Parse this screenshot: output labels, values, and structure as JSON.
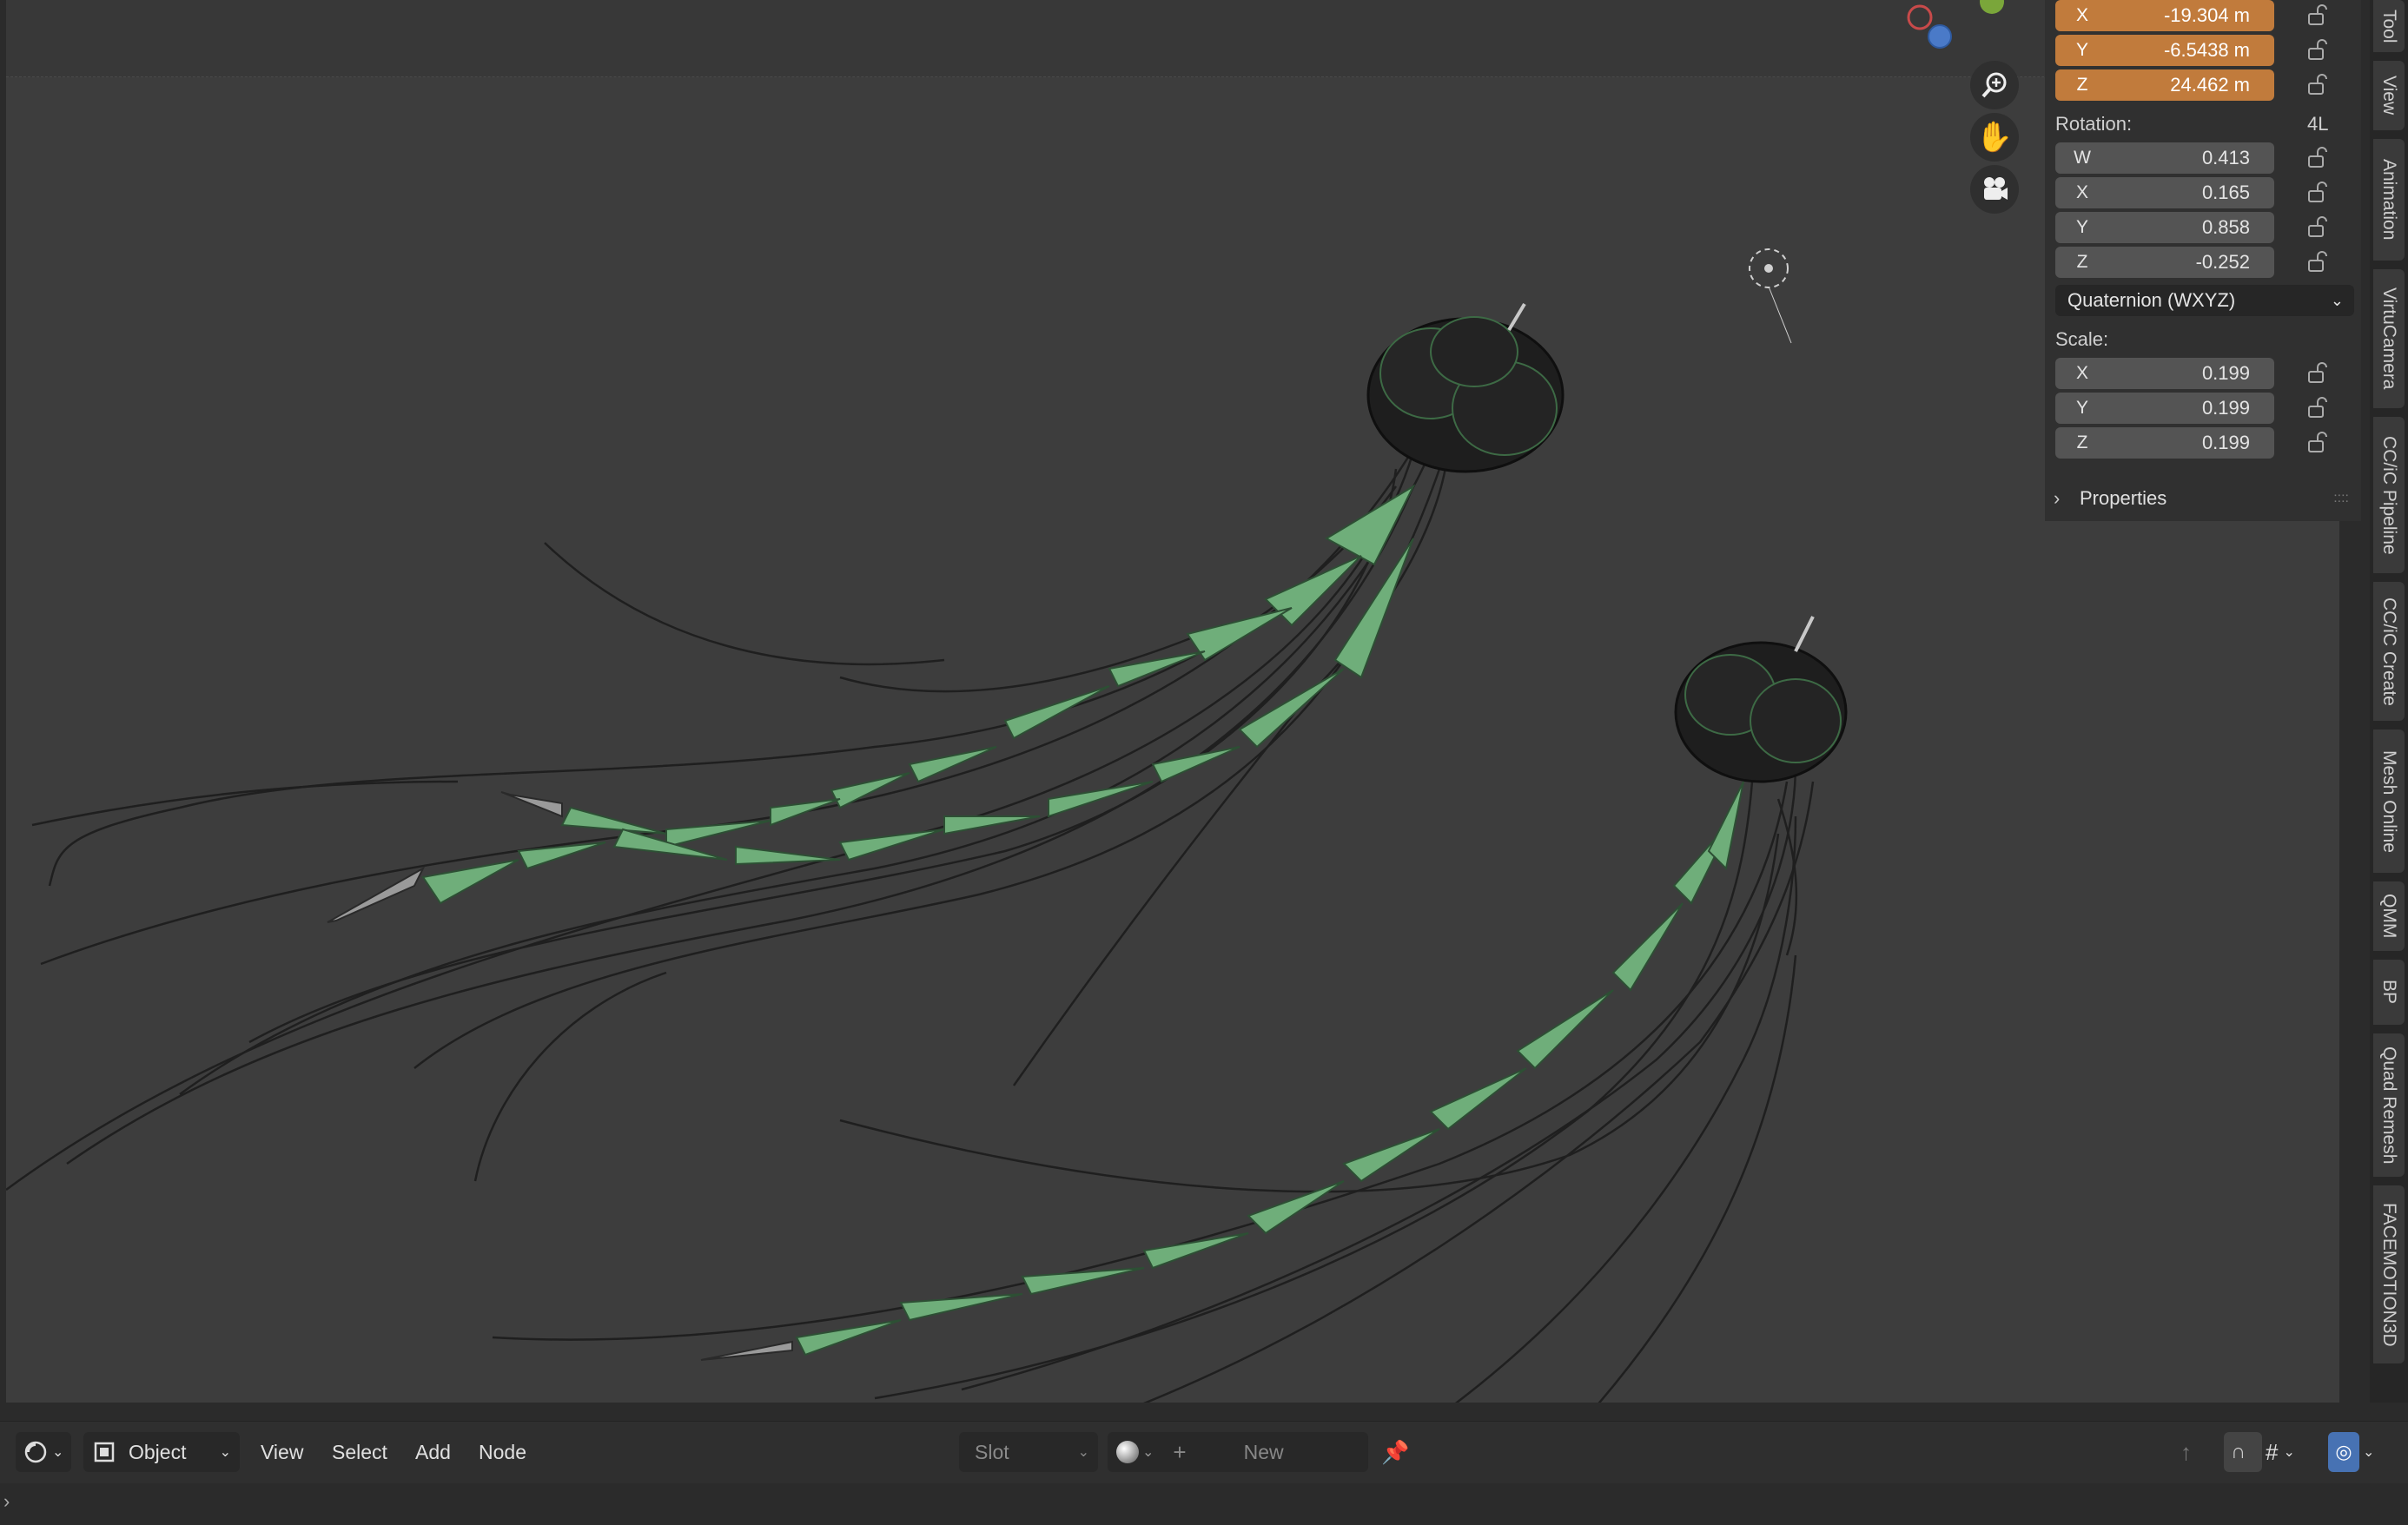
{
  "transform": {
    "location": [
      {
        "axis": "X",
        "value": "-19.304 m"
      },
      {
        "axis": "Y",
        "value": "-6.5438 m"
      },
      {
        "axis": "Z",
        "value": "24.462 m"
      }
    ],
    "rotation_label": "Rotation:",
    "rotation_mode_short": "4L",
    "rotation": [
      {
        "axis": "W",
        "value": "0.413"
      },
      {
        "axis": "X",
        "value": "0.165"
      },
      {
        "axis": "Y",
        "value": "0.858"
      },
      {
        "axis": "Z",
        "value": "-0.252"
      }
    ],
    "rotation_mode": "Quaternion (WXYZ)",
    "scale_label": "Scale:",
    "scale": [
      {
        "axis": "X",
        "value": "0.199"
      },
      {
        "axis": "Y",
        "value": "0.199"
      },
      {
        "axis": "Z",
        "value": "0.199"
      }
    ],
    "properties_label": "Properties"
  },
  "side_tabs": [
    "Tool",
    "View",
    "Animation",
    "VirtuCamera",
    "CC/iC Pipeline",
    "CC/iC Create",
    "Mesh Online",
    "QMM",
    "BP",
    "Quad Remesh",
    "FACEMOTION3D"
  ],
  "header": {
    "mode": "Object",
    "menus": [
      "View",
      "Select",
      "Add",
      "Node"
    ],
    "slot": "Slot",
    "new_label": "New"
  },
  "colors": {
    "accent_orange": "#c17b3c",
    "bone_green": "#6fae7a",
    "viewport_bg": "#3d3d3d"
  }
}
